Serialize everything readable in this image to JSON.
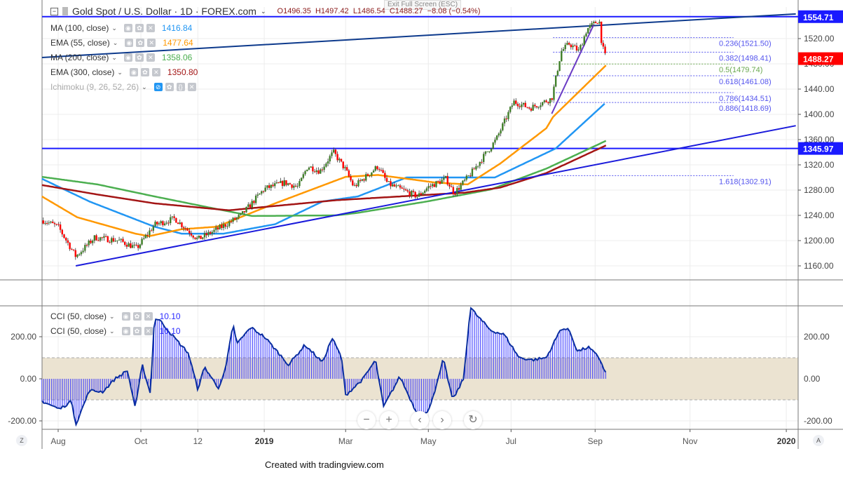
{
  "header": {
    "symbol": "Gold Spot / U.S. Dollar · 1D · FOREX.com",
    "open": "O1496.35",
    "high": "H1497.42",
    "low": "L1486.54",
    "close": "C1488.27",
    "change": "−8.08 (−0.54%)",
    "tooltip": "Exit Full Screen (ESC)"
  },
  "indicators": [
    {
      "label": "MA (100, close)",
      "value": "1416.84",
      "color": "#2196f3"
    },
    {
      "label": "EMA (55, close)",
      "value": "1477.64",
      "color": "#ff9800"
    },
    {
      "label": "MA (200, close)",
      "value": "1358.06",
      "color": "#4caf50"
    },
    {
      "label": "EMA (300, close)",
      "value": "1350.80",
      "color": "#a31515"
    },
    {
      "label": "Ichimoku (9, 26, 52, 26)",
      "value": "",
      "color": "#999999"
    }
  ],
  "cci_legend": [
    {
      "label": "CCI (50, close)",
      "value": "10.10"
    },
    {
      "label": "CCI (50, close)",
      "value": "10.10"
    }
  ],
  "nav": {
    "zoom_out": "−",
    "zoom_in": "+",
    "back": "‹",
    "forward": "›",
    "reset": "↻"
  },
  "corner": {
    "left": "Z",
    "right": "A"
  },
  "footer": "Created with tradingview.com",
  "chart_data": [
    {
      "type": "candlestick",
      "title": "Gold Spot / U.S. Dollar 1D",
      "x_unit": "days since 2018-08-01",
      "ylim": [
        1140,
        1570
      ],
      "y_ticks": [
        "1160.00",
        "1200.00",
        "1240.00",
        "1280.00",
        "1320.00",
        "1360.00",
        "1400.00",
        "1440.00",
        "1480.00",
        "1520.00"
      ],
      "x_ticks": [
        {
          "label": "Aug",
          "d": 0,
          "bold": false
        },
        {
          "label": "Oct",
          "d": 61,
          "bold": false
        },
        {
          "label": "12",
          "d": 103,
          "bold": false
        },
        {
          "label": "2019",
          "d": 152,
          "bold": true
        },
        {
          "label": "Mar",
          "d": 212,
          "bold": false
        },
        {
          "label": "May",
          "d": 273,
          "bold": false
        },
        {
          "label": "Jul",
          "d": 334,
          "bold": false
        },
        {
          "label": "Sep",
          "d": 396,
          "bold": false
        },
        {
          "label": "Nov",
          "d": 466,
          "bold": false
        },
        {
          "label": "2020",
          "d": 537,
          "bold": true
        }
      ],
      "close_keypoints": [
        [
          -11,
          1232
        ],
        [
          0,
          1222
        ],
        [
          13,
          1175
        ],
        [
          27,
          1205
        ],
        [
          45,
          1200
        ],
        [
          58,
          1188
        ],
        [
          71,
          1225
        ],
        [
          86,
          1235
        ],
        [
          103,
          1202
        ],
        [
          121,
          1222
        ],
        [
          135,
          1240
        ],
        [
          152,
          1282
        ],
        [
          167,
          1292
        ],
        [
          177,
          1285
        ],
        [
          184,
          1318
        ],
        [
          193,
          1310
        ],
        [
          203,
          1340
        ],
        [
          212,
          1312
        ],
        [
          218,
          1285
        ],
        [
          236,
          1318
        ],
        [
          243,
          1290
        ],
        [
          265,
          1270
        ],
        [
          273,
          1285
        ],
        [
          286,
          1298
        ],
        [
          292,
          1275
        ],
        [
          304,
          1305
        ],
        [
          323,
          1360
        ],
        [
          336,
          1420
        ],
        [
          348,
          1410
        ],
        [
          364,
          1425
        ],
        [
          371,
          1500
        ],
        [
          377,
          1512
        ],
        [
          384,
          1500
        ],
        [
          390,
          1535
        ],
        [
          399,
          1550
        ],
        [
          401,
          1510
        ],
        [
          404,
          1488
        ]
      ],
      "moving_averages": [
        {
          "name": "MA 100",
          "color": "#2196f3",
          "points": [
            [
              -12,
              1298
            ],
            [
              23,
              1262
            ],
            [
              71,
              1222
            ],
            [
              91,
              1211
            ],
            [
              122,
              1211
            ],
            [
              160,
              1226
            ],
            [
              195,
              1262
            ],
            [
              221,
              1270
            ],
            [
              257,
              1300
            ],
            [
              322,
              1300
            ],
            [
              367,
              1346
            ],
            [
              403,
              1416.84
            ]
          ]
        },
        {
          "name": "EMA 55",
          "color": "#ff9800",
          "points": [
            [
              -12,
              1270
            ],
            [
              14,
              1237
            ],
            [
              57,
              1211
            ],
            [
              67,
              1207
            ],
            [
              91,
              1218
            ],
            [
              117,
              1222
            ],
            [
              160,
              1259
            ],
            [
              212,
              1301
            ],
            [
              236,
              1304
            ],
            [
              278,
              1292
            ],
            [
              302,
              1289
            ],
            [
              326,
              1322
            ],
            [
              360,
              1378
            ],
            [
              365,
              1396
            ],
            [
              404,
              1477.64
            ]
          ]
        },
        {
          "name": "MA 200",
          "color": "#4caf50",
          "points": [
            [
              -12,
              1301
            ],
            [
              29,
              1289
            ],
            [
              71,
              1270
            ],
            [
              117,
              1250
            ],
            [
              143,
              1239
            ],
            [
              205,
              1240
            ],
            [
              221,
              1244
            ],
            [
              272,
              1262
            ],
            [
              319,
              1281
            ],
            [
              360,
              1314
            ],
            [
              404,
              1358.06
            ]
          ]
        },
        {
          "name": "EMA 300",
          "color": "#a31515",
          "points": [
            [
              -12,
              1288
            ],
            [
              29,
              1273
            ],
            [
              71,
              1259
            ],
            [
              126,
              1248
            ],
            [
              205,
              1264
            ],
            [
              300,
              1276
            ],
            [
              326,
              1284
            ],
            [
              360,
              1307
            ],
            [
              404,
              1350.8
            ]
          ]
        }
      ],
      "trendlines": [
        {
          "name": "upper-channel",
          "color": "#0d3a8c",
          "from": [
            -12,
            1490
          ],
          "to": [
            544,
            1559
          ]
        },
        {
          "name": "support",
          "color": "#1a1adb",
          "from": [
            13,
            1160
          ],
          "to": [
            544,
            1382
          ]
        },
        {
          "name": "swing",
          "color": "#6a3bc4",
          "from": [
            364,
            1401
          ],
          "to": [
            395,
            1542
          ]
        }
      ],
      "horizontal_lines": [
        {
          "value": 1554.71,
          "label": "1554.71",
          "color": "#1a1aff"
        },
        {
          "value": 1345.97,
          "label": "1345.97",
          "color": "#1a1aff"
        }
      ],
      "last_price": {
        "value": 1488.27,
        "label": "1488.27",
        "color": "#ff0000"
      },
      "fibonacci": {
        "range_d": [
          365,
          498
        ],
        "levels": [
          {
            "ratio": "0.236",
            "value": 1521.5,
            "label": "0.236(1521.50)",
            "color": "#5555ee"
          },
          {
            "ratio": "0.382",
            "value": 1498.41,
            "label": "0.382(1498.41)",
            "color": "#5555ee"
          },
          {
            "ratio": "0.5",
            "value": 1479.74,
            "label": "0.5(1479.74)",
            "color": "#6aa84f"
          },
          {
            "ratio": "0.618",
            "value": 1461.08,
            "label": "0.618(1461.08)",
            "color": "#5555ee"
          },
          {
            "ratio": "0.786",
            "value": 1434.51,
            "label": "0.786(1434.51)",
            "color": "#5555ee"
          },
          {
            "ratio": "0.886",
            "value": 1418.69,
            "label": "0.886(1418.69)",
            "color": "#5555ee"
          },
          {
            "ratio": "1.618",
            "value": 1302.91,
            "label": "1.618(1302.91)",
            "color": "#5555ee"
          }
        ]
      }
    },
    {
      "type": "bar",
      "title": "CCI (50, close)",
      "x_unit": "days since 2018-08-01",
      "ylim": [
        -240,
        340
      ],
      "y_ticks": [
        "200.00",
        "0.00",
        "-200.00"
      ],
      "band": [
        -100,
        100
      ],
      "band_color": "#ebe3d1",
      "line_color": "#0b2fa0",
      "bar_color": "#2b2bff",
      "points": [
        [
          -12,
          -106
        ],
        [
          1,
          -144
        ],
        [
          10,
          -106
        ],
        [
          13,
          -217
        ],
        [
          23,
          -56
        ],
        [
          33,
          -61
        ],
        [
          42,
          0
        ],
        [
          51,
          39
        ],
        [
          57,
          -139
        ],
        [
          62,
          67
        ],
        [
          68,
          -72
        ],
        [
          71,
          289
        ],
        [
          75,
          278
        ],
        [
          85,
          200
        ],
        [
          96,
          122
        ],
        [
          103,
          -50
        ],
        [
          108,
          56
        ],
        [
          118,
          -44
        ],
        [
          123,
          33
        ],
        [
          129,
          256
        ],
        [
          132,
          167
        ],
        [
          142,
          244
        ],
        [
          152,
          200
        ],
        [
          158,
          156
        ],
        [
          170,
          67
        ],
        [
          182,
          161
        ],
        [
          195,
          78
        ],
        [
          202,
          194
        ],
        [
          209,
          100
        ],
        [
          212,
          -78
        ],
        [
          225,
          0
        ],
        [
          234,
          89
        ],
        [
          240,
          -133
        ],
        [
          252,
          11
        ],
        [
          264,
          -156
        ],
        [
          272,
          -167
        ],
        [
          279,
          -33
        ],
        [
          284,
          94
        ],
        [
          291,
          -100
        ],
        [
          299,
          0
        ],
        [
          304,
          339
        ],
        [
          309,
          300
        ],
        [
          319,
          230
        ],
        [
          329,
          210
        ],
        [
          340,
          100
        ],
        [
          350,
          90
        ],
        [
          360,
          100
        ],
        [
          371,
          240
        ],
        [
          377,
          230
        ],
        [
          383,
          130
        ],
        [
          391,
          150
        ],
        [
          399,
          100
        ],
        [
          405,
          10
        ]
      ]
    }
  ]
}
